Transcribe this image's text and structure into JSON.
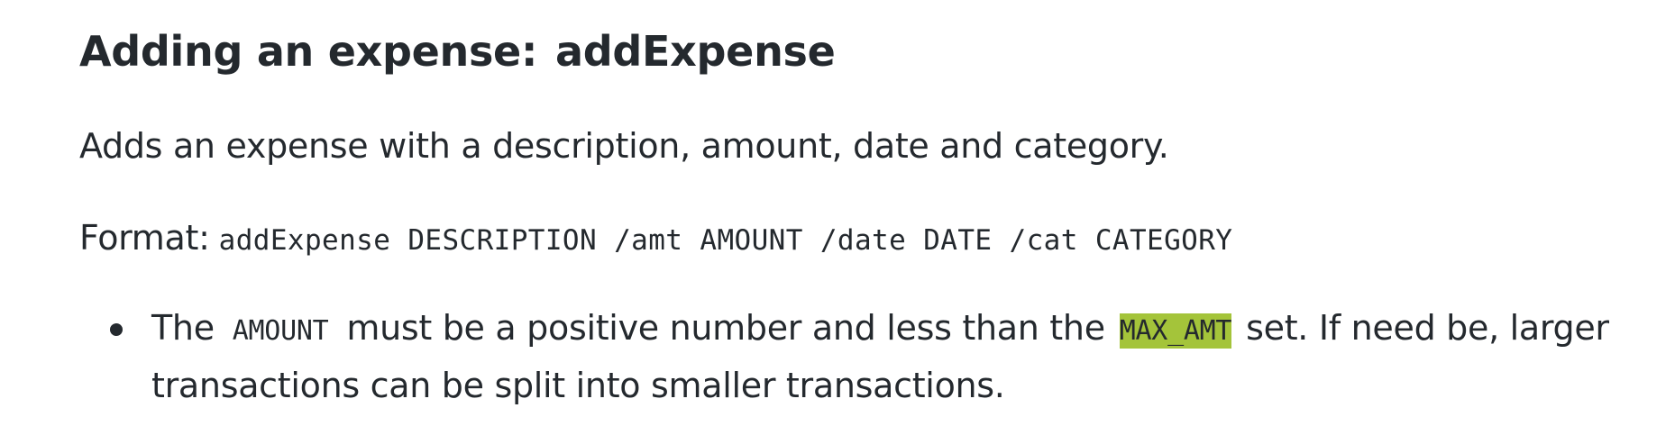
{
  "heading": {
    "text": "Adding an expense:",
    "command": "addExpense"
  },
  "description": "Adds an expense with a description, amount, date and category.",
  "format": {
    "label": "Format:",
    "syntax": "addExpense DESCRIPTION /amt AMOUNT /date DATE /cat CATEGORY"
  },
  "notes": [
    {
      "part1": "The",
      "code1": "AMOUNT",
      "part2": "must be a positive number and less than the",
      "code2": "MAX_AMT",
      "part3": "set. If need be, larger transactions can be split into smaller transactions."
    }
  ],
  "colors": {
    "highlight": "#a4c43a",
    "text": "#24292e"
  }
}
